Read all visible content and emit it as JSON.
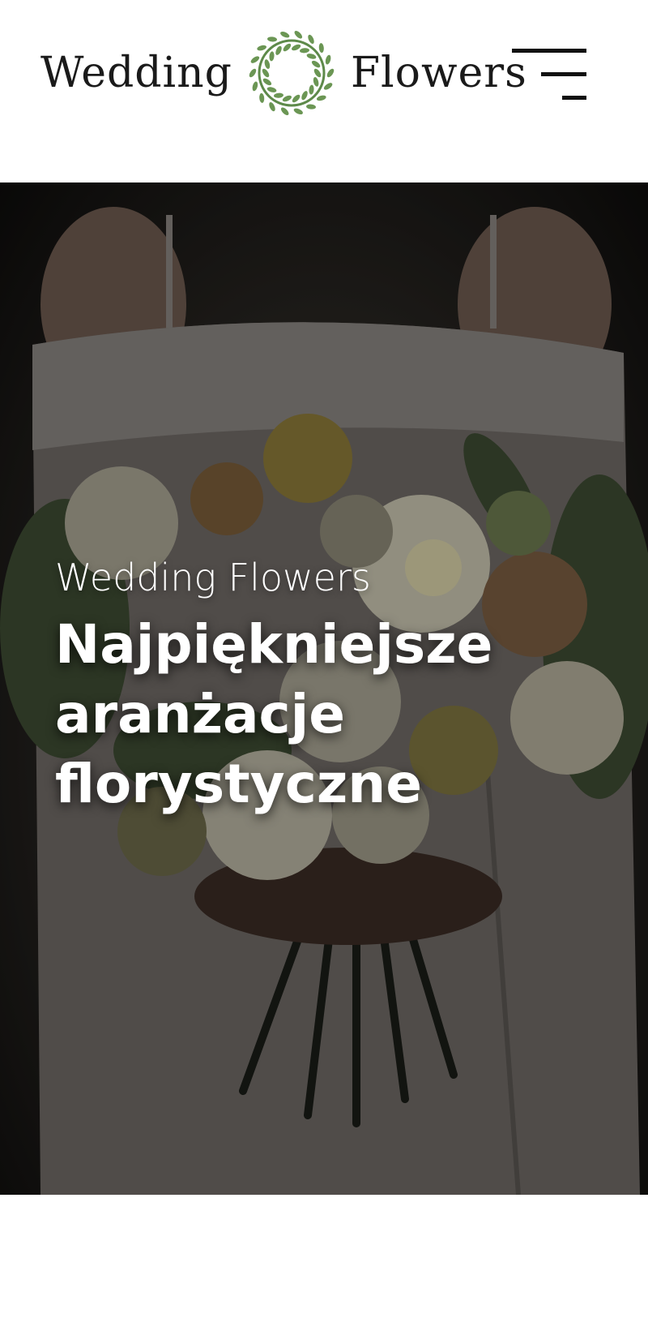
{
  "header": {
    "logo_left": "Wedding",
    "logo_right": "Flowers",
    "logo_icon": "laurel-wreath-icon",
    "menu_icon": "hamburger-menu-icon"
  },
  "hero": {
    "eyebrow": "Wedding Flowers",
    "headline_lines": [
      "Najpiękniejsze",
      "aranżacje",
      "florystyczne"
    ]
  },
  "colors": {
    "wreath_green": "#5e8a4a",
    "overlay": "#000000",
    "text": "#ffffff"
  }
}
